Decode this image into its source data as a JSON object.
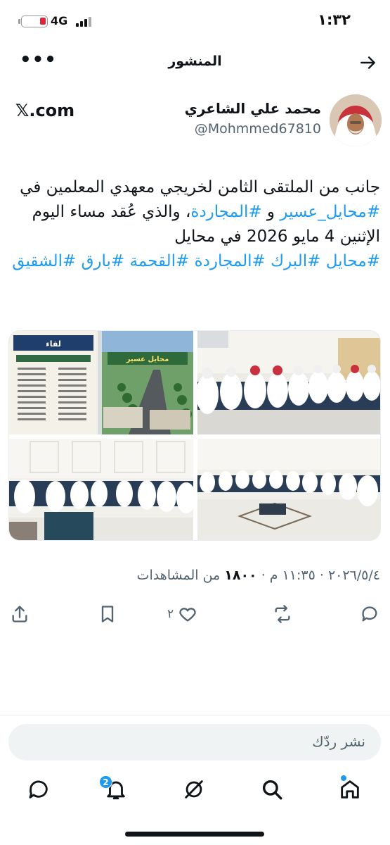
{
  "status_bar": {
    "time": "١:٣٢",
    "network": "4G",
    "battery_level": 0.25
  },
  "header": {
    "title": "المنشور",
    "back_icon": "arrow-right-icon",
    "more_icon": "more-dots-icon",
    "more_label": "•••"
  },
  "author": {
    "name": "محمد علي الشاعري",
    "handle": "@Mohmmed67810",
    "source": "𝕏.com"
  },
  "post": {
    "p1": "جانب من الملتقى الثامن لخريجي معهدي المعلمين في ",
    "tag1": "#محايل_عسير",
    "p2": " و ",
    "tag2": "#المجاردة",
    "p3": "، والذي عُقد مساء اليوم الإثنين 4 مايو 2026 في محايل ",
    "tag3": "#محايل",
    "tag4": "#البرك",
    "tag5": "#المجاردة",
    "tag6": "#القحمة",
    "tag7": "#بارق",
    "tag8": "#الشقيق"
  },
  "media": {
    "poster_title": "لقاء",
    "banner_text": "محايل عسير"
  },
  "meta": {
    "date": "٢٠٢٦/٥/٤",
    "sep": " · ",
    "time": "١١:٣٥ م",
    "views": "١٨٠٠",
    "views_label": " من المشاهدات"
  },
  "actions": {
    "reply_icon": "reply-icon",
    "retweet_icon": "retweet-icon",
    "like_icon": "heart-icon",
    "like_count": "٢",
    "bookmark_icon": "bookmark-icon",
    "share_icon": "share-icon"
  },
  "reply_bar": {
    "placeholder": "نشر ردّك"
  },
  "bottom_nav": {
    "home_icon": "home-icon",
    "search_icon": "search-icon",
    "grok_icon": "grok-icon",
    "notifications_icon": "bell-icon",
    "notifications_badge": "2",
    "messages_icon": "message-icon"
  },
  "colors": {
    "accent": "#1d9bf0",
    "text": "#0f1419",
    "secondary": "#536471",
    "battery_low": "#e0243a"
  }
}
